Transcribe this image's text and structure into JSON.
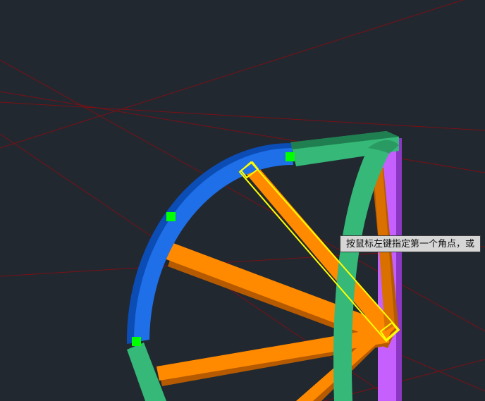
{
  "canvas": {
    "background": "#212830",
    "construction_line_color": "#7a1016",
    "colors": {
      "rim_blue": "#1e6fe8",
      "rim_blue_dark": "#0b4db5",
      "rim_green": "#35b878",
      "rim_green_dark": "#1f7f50",
      "spoke_orange": "#ff8a00",
      "spoke_orange_dark": "#b55a00",
      "post_purple": "#c560ff",
      "grip_green": "#00ff00",
      "selection_yellow": "#ffff00"
    }
  },
  "prompt": {
    "text": "按鼠标左键指定第一个角点，或"
  }
}
